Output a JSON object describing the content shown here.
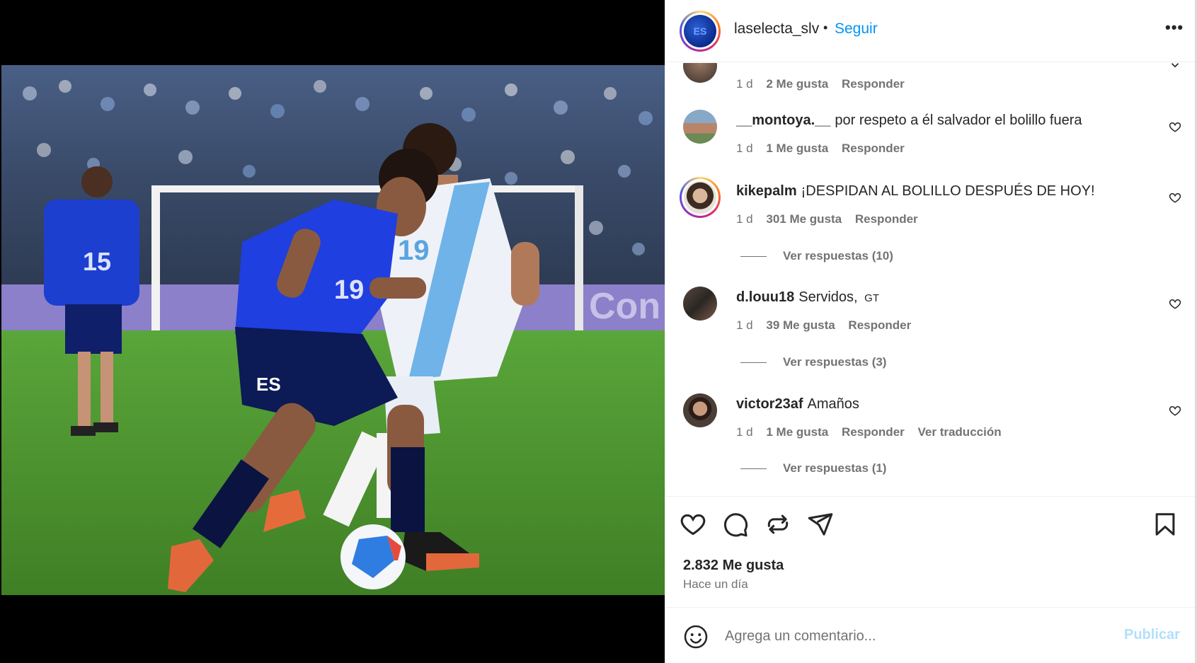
{
  "post": {
    "username": "laselecta_slv",
    "separator": "•",
    "follow_label": "Seguir",
    "more_icon": "more-horizontal-icon",
    "avatar_text": "ES"
  },
  "photo": {
    "jersey_front": "ES",
    "number_main": "19",
    "number_gt": "19",
    "number_back": "15"
  },
  "comments": [
    {
      "meta_time": "1 d",
      "meta_likes": "2 Me gusta",
      "meta_reply": "Responder"
    },
    {
      "username": "__montoya.__",
      "text": "por respeto a él salvador el bolillo fuera",
      "meta_time": "1 d",
      "meta_likes": "1 Me gusta",
      "meta_reply": "Responder"
    },
    {
      "username": "kikepalm",
      "text": "¡DESPIDAN AL BOLILLO DESPUÉS DE HOY!",
      "meta_time": "1 d",
      "meta_likes": "301 Me gusta",
      "meta_reply": "Responder",
      "view_replies": "Ver respuestas (10)"
    },
    {
      "username": "d.louu18",
      "text": "Servidos,",
      "suffix": "GT",
      "meta_time": "1 d",
      "meta_likes": "39 Me gusta",
      "meta_reply": "Responder",
      "view_replies": "Ver respuestas (3)"
    },
    {
      "username": "victor23af",
      "text": "Amaños",
      "meta_time": "1 d",
      "meta_likes": "1 Me gusta",
      "meta_reply": "Responder",
      "meta_translate": "Ver traducción",
      "view_replies": "Ver respuestas (1)"
    }
  ],
  "actions": {
    "icons": [
      "heart-icon",
      "comment-icon",
      "repost-icon",
      "share-icon",
      "bookmark-icon"
    ],
    "likes": "2.832 Me gusta",
    "time": "Hace un día"
  },
  "add_comment": {
    "placeholder": "Agrega un comentario...",
    "publish_label": "Publicar",
    "publish_color": "#b2dffc"
  },
  "colors": {
    "link_blue": "#0095f6",
    "secondary_text": "#737373",
    "primary_text": "#262626"
  }
}
